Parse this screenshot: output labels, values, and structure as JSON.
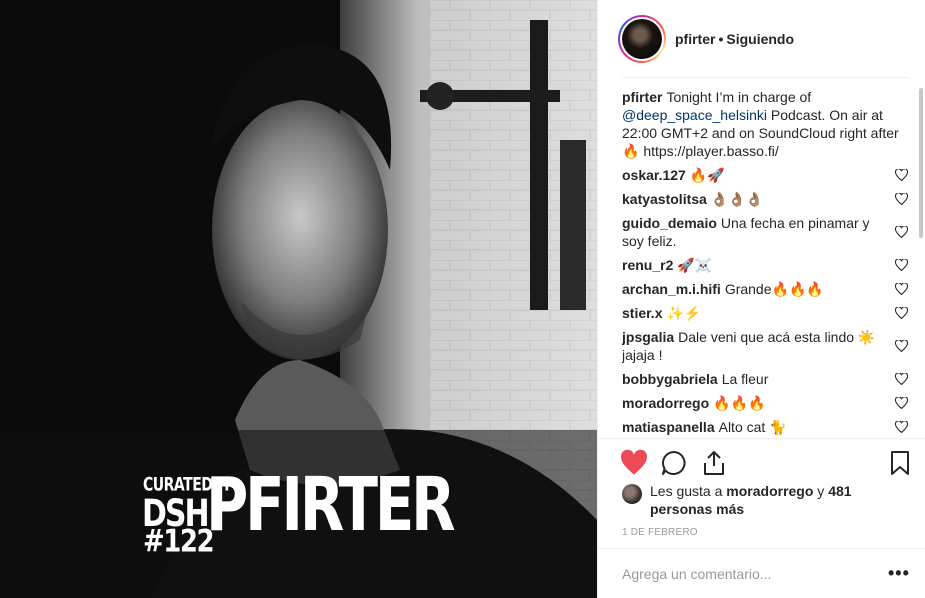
{
  "post": {
    "overlay": {
      "curated_by": "CURATEDBY",
      "dsh": "DSH",
      "number": "#122",
      "name": "PFIRTER"
    }
  },
  "header": {
    "username": "pfirter",
    "separator": "•",
    "follow_status": "Siguiendo"
  },
  "caption": {
    "username": "pfirter",
    "text_before": "Tonight I’m in charge of",
    "mention": "@deep_space_helsinki",
    "text_after": "Podcast. On air at 22:00 GMT+2 and on SoundCloud right after 🔥 https://player.basso.fi/"
  },
  "comments": [
    {
      "user": "oskar.127",
      "text": "🔥🚀"
    },
    {
      "user": "katyastolitsa",
      "text": "👌🏽👌🏽👌🏽"
    },
    {
      "user": "guido_demaio",
      "text": "Una fecha en pinamar y soy feliz."
    },
    {
      "user": "renu_r2",
      "text": "🚀☠️"
    },
    {
      "user": "archan_m.i.hifi",
      "text": "Grande🔥🔥🔥"
    },
    {
      "user": "stier.x",
      "text": "✨⚡"
    },
    {
      "user": "jpsgalia",
      "text": "Dale veni que acá esta lindo ☀️ jajaja !"
    },
    {
      "user": "bobbygabriela",
      "text": "La fleur"
    },
    {
      "user": "moradorrego",
      "text": "🔥🔥🔥"
    },
    {
      "user": "matiaspanella",
      "text": "Alto cat 🐈"
    }
  ],
  "likes": {
    "prefix": "Les gusta a",
    "user": "moradorrego",
    "conj": "y",
    "others": "481 personas más"
  },
  "date": "1 DE FEBRERO",
  "add_comment": {
    "placeholder": "Agrega un comentario...",
    "more": "•••"
  },
  "colors": {
    "like_red": "#ed4956",
    "mention_blue": "#003569",
    "muted": "#999999"
  },
  "icons": {
    "like": "heart-filled-icon",
    "comment": "comment-bubble-icon",
    "share": "share-icon",
    "save": "bookmark-icon",
    "comment_like": "heart-outline-icon"
  }
}
